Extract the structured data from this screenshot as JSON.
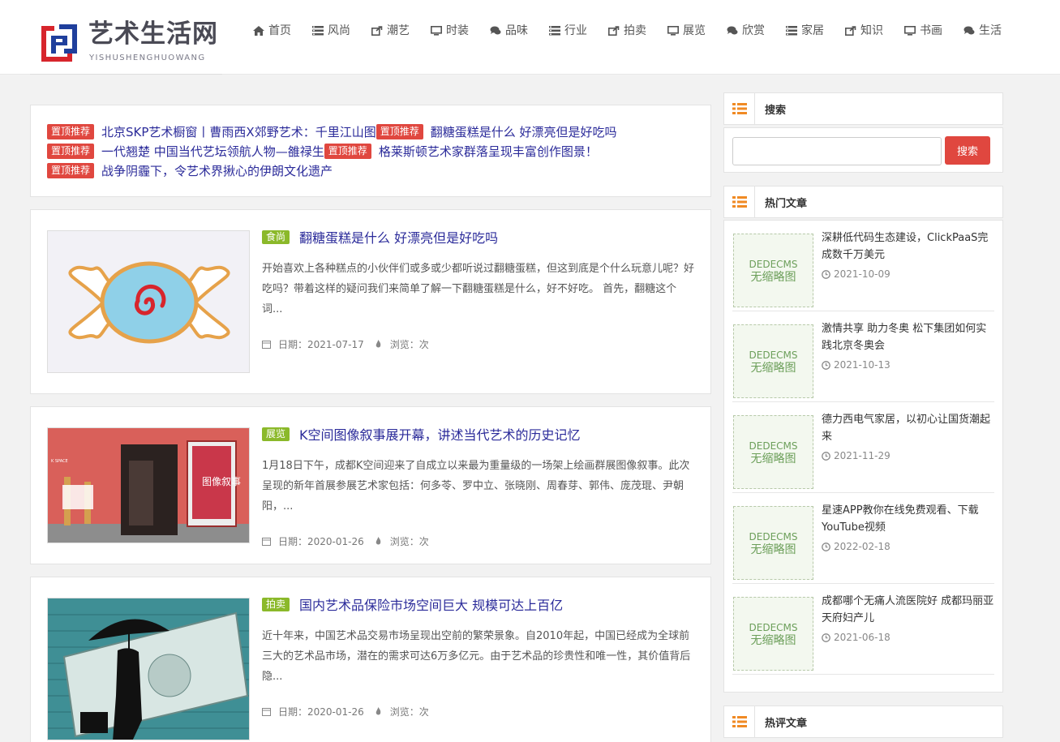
{
  "brand": {
    "name_cn": "艺术生活网",
    "name_en": "YISHUSHENGHUOWANG",
    "colors": {
      "red": "#d7252c",
      "blue": "#1f3f9c",
      "accent_red": "#e0473f",
      "accent_green": "#8bb92a",
      "link": "#2b2b9a",
      "sidebar_icon": "#f08a24"
    }
  },
  "nav": [
    {
      "label": "首页",
      "icon": "home-icon"
    },
    {
      "label": "风尚",
      "icon": "list-icon"
    },
    {
      "label": "潮艺",
      "icon": "share-icon"
    },
    {
      "label": "时装",
      "icon": "monitor-icon"
    },
    {
      "label": "品味",
      "icon": "chat-icon"
    },
    {
      "label": "行业",
      "icon": "list-icon"
    },
    {
      "label": "拍卖",
      "icon": "share-icon"
    },
    {
      "label": "展览",
      "icon": "monitor-icon"
    },
    {
      "label": "欣赏",
      "icon": "chat-icon"
    },
    {
      "label": "家居",
      "icon": "list-icon"
    },
    {
      "label": "知识",
      "icon": "share-icon"
    },
    {
      "label": "书画",
      "icon": "monitor-icon"
    },
    {
      "label": "生活",
      "icon": "chat-icon"
    }
  ],
  "sticky": {
    "tag": "置顶推荐",
    "lines": [
      [
        "北京SKP艺术橱窗丨曹雨西X郊野艺术：千里江山图",
        "翻糖蛋糕是什么 好漂亮但是好吃吗"
      ],
      [
        "一代翘楚 中国当代艺坛领航人物—雒禄生",
        "格莱斯顿艺术家群落呈现丰富创作图景！"
      ],
      [
        "战争阴霾下，令艺术界揪心的伊朗文化遗产"
      ]
    ]
  },
  "articles": [
    {
      "tag": "食尚",
      "title": "翻糖蛋糕是什么 好漂亮但是好吃吗",
      "desc": "开始喜欢上各种糕点的小伙伴们或多或少都听说过翻糖蛋糕，但这到底是个什么玩意儿呢？好吃吗？带着这样的疑问我们来简单了解一下翻糖蛋糕是什么，好不好吃。 首先，翻糖这个词...",
      "date": "日期：2021-07-17",
      "views": "浏览：次",
      "image": "candy-cookie-image"
    },
    {
      "tag": "展览",
      "title": "K空间图像叙事展开幕，讲述当代艺术的历史记忆",
      "desc": "1月18日下午，成都K空间迎来了自成立以来最为重量级的一场架上绘画群展图像叙事。此次呈现的新年首展参展艺术家包括：何多苓、罗中立、张晓刚、周春芽、郭伟、庞茂琨、尹朝阳，...",
      "date": "日期：2020-01-26",
      "views": "浏览：次",
      "image": "gallery-entrance-image",
      "poster_text": "图像叙事"
    },
    {
      "tag": "拍卖",
      "title": "国内艺术品保险市场空间巨大 规模可达上百亿",
      "desc": "近十年来，中国艺术品交易市场呈现出空前的繁荣景象。自2010年起，中国已经成为全球前三大的艺术品市场，潜在的需求可达6万多亿元。由于艺术品的珍贵性和唯一性，其价值背后隐...",
      "date": "日期：2020-01-26",
      "views": "浏览：次",
      "image": "umbrella-dollar-image"
    }
  ],
  "sidebar": {
    "search": {
      "title": "搜索",
      "placeholder": "",
      "button": "搜索"
    },
    "hot": {
      "title": "热门文章",
      "thumb_line1": "DEDECMS",
      "thumb_line2": "无缩略图",
      "items": [
        {
          "title": "深耕低代码生态建设，ClickPaaS完成数千万美元",
          "date": "2021-10-09"
        },
        {
          "title": "激情共享 助力冬奥 松下集团如何实践北京冬奥会",
          "date": "2021-10-13"
        },
        {
          "title": "德力西电气家居，以初心让国货潮起来",
          "date": "2021-11-29"
        },
        {
          "title": "星速APP教你在线免费观看、下载YouTube视频",
          "date": "2022-02-18"
        },
        {
          "title": "成都哪个无痛人流医院好 成都玛丽亚天府妇产儿",
          "date": "2021-06-18"
        }
      ]
    },
    "review": {
      "title": "热评文章"
    }
  }
}
